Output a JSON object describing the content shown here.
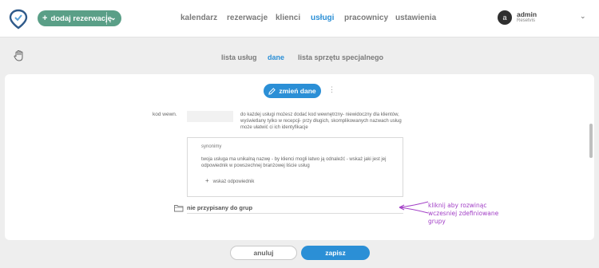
{
  "header": {
    "add_booking_label": "dodaj rezerwację",
    "nav": [
      "kalendarz",
      "rezerwacje",
      "klienci",
      "usługi",
      "pracownicy",
      "ustawienia"
    ],
    "active_nav": "usługi",
    "user": {
      "initial": "a",
      "name": "admin",
      "company": "Resetvis"
    }
  },
  "subtabs": {
    "items": [
      "lista usług",
      "dane",
      "lista sprzętu specjalnego"
    ],
    "active": "dane"
  },
  "form": {
    "edit_button": "zmień dane",
    "code_label": "kod wewn.",
    "code_value": "",
    "code_help": "do każdej usługi możesz dodać kod wewnętrzny- niewidoczny dla klientów, wyświetlany tylko w recepcji- przy długich, skomplikowanych nazwach usług może ułatwić ci ich identyfikacje",
    "synonyms_title": "synonimy",
    "synonyms_desc": "twoja usługa ma unikalną nazwę - by klienci mogli łatwo ją odnaleźć - wskaż jaki jest jej odpowiednik w powszechnej branżowej liście usług",
    "synonyms_add": "wskaż odpowiednik",
    "group_value": "nie przypisany do grup",
    "annotation": "kliknij aby rozwinąc wczesniej zdefiniowane grupy"
  },
  "footer": {
    "cancel_label": "anuluj",
    "save_label": "zapisz"
  },
  "colors": {
    "accent": "#2b8fd6",
    "brand_green": "#5a9f87",
    "annotation": "#a23fc6"
  },
  "icons": [
    "logo-icon",
    "plus-icon",
    "chevron-down-icon",
    "hand-icon",
    "pencil-icon",
    "kebab-icon",
    "folder-icon"
  ]
}
